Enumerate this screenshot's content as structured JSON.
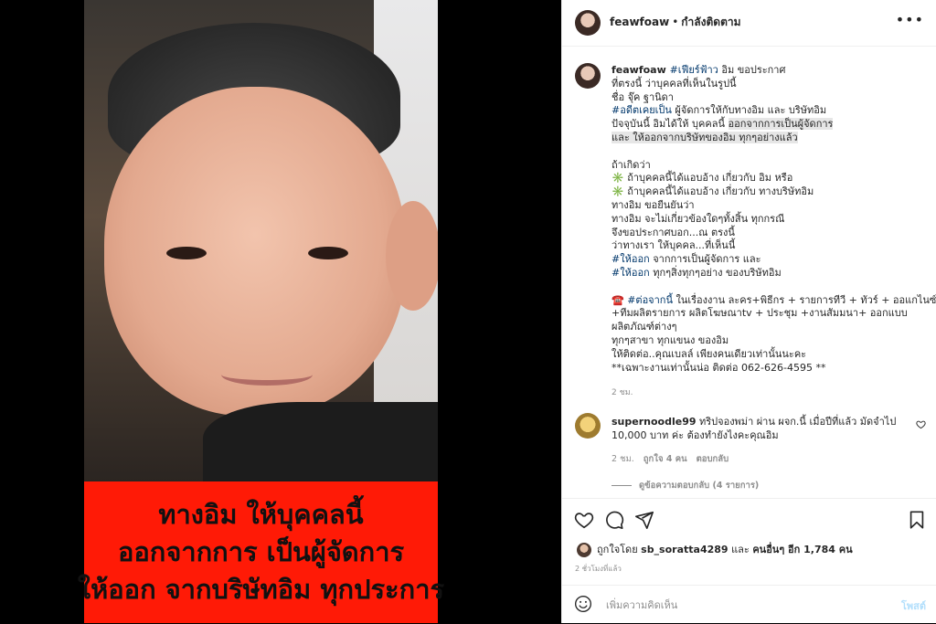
{
  "header": {
    "username": "feawfoaw",
    "separator": "•",
    "follow_status": "กำลังติดตาม",
    "more_icon": "more-horizontal-icon"
  },
  "photo_caption_lines": [
    "ทางอิม ให้บุคคลนี้",
    "ออกจากการ เป็นผู้จัดการ",
    "ให้ออก จากบริษัทอิม ทุกประการ"
  ],
  "caption": {
    "username": "feawfoaw",
    "lines": [
      {
        "parts": [
          {
            "t": "#เฟียร์ฟ้าว",
            "cls": "tag"
          },
          {
            "t": " อิม ขอประกาศ",
            "cls": ""
          }
        ]
      },
      {
        "parts": [
          {
            "t": "ที่ตรงนี้ ว่าบุคคลที่เห็นในรูปนี้",
            "cls": ""
          }
        ]
      },
      {
        "parts": [
          {
            "t": "ชื่อ จุ๊ค ฐานิดา",
            "cls": ""
          }
        ]
      },
      {
        "parts": [
          {
            "t": "#อดีตเคยเป็น",
            "cls": "tag"
          },
          {
            "t": " ผู้จัดการให้กับทางอิม และ บริษัทอิม",
            "cls": ""
          }
        ]
      },
      {
        "parts": [
          {
            "t": "ปัจจุบันนี้ อิมได้ให้ บุคคลนี้ ",
            "cls": ""
          },
          {
            "t": "ออกจากการเป็นผู้จัดการ",
            "cls": "hl"
          }
        ]
      },
      {
        "parts": [
          {
            "t": "และ ให้ออกจากบริษัทของอิม ทุกๆอย่างแล้ว",
            "cls": "hl"
          }
        ]
      },
      {
        "blank": true
      },
      {
        "parts": [
          {
            "t": "ถ้าเกิดว่า",
            "cls": ""
          }
        ]
      },
      {
        "parts": [
          {
            "t": "✳️ ถ้าบุคคลนี้ได้แอบอ้าง เกี่ยวกับ อิม หรือ",
            "cls": ""
          }
        ]
      },
      {
        "parts": [
          {
            "t": "✳️ ถ้าบุคคลนี้ได้แอบอ้าง เกี่ยวกับ ทางบริษัทอิม",
            "cls": ""
          }
        ]
      },
      {
        "parts": [
          {
            "t": "ทางอิม ขอยืนยันว่า",
            "cls": ""
          }
        ]
      },
      {
        "parts": [
          {
            "t": "ทางอิม จะไม่เกี่ยวข้องใดๆทั้งสิ้น ทุกกรณี",
            "cls": ""
          }
        ]
      },
      {
        "parts": [
          {
            "t": "จึงขอประกาศบอก...ณ ตรงนี้",
            "cls": ""
          }
        ]
      },
      {
        "parts": [
          {
            "t": "ว่าทางเรา ให้บุคคล...ที่เห็นนี้",
            "cls": ""
          }
        ]
      },
      {
        "parts": [
          {
            "t": "#ให้ออก",
            "cls": "tag"
          },
          {
            "t": " จากการเป็นผู้จัดการ และ",
            "cls": ""
          }
        ]
      },
      {
        "parts": [
          {
            "t": "#ให้ออก",
            "cls": "tag"
          },
          {
            "t": " ทุกๆสิ่งทุกๆอย่าง ของบริษัทอิม",
            "cls": ""
          }
        ]
      },
      {
        "blank": true
      },
      {
        "parts": [
          {
            "t": "☎️ ",
            "cls": ""
          },
          {
            "t": "#ต่อจากนี้",
            "cls": "tag"
          },
          {
            "t": " ในเรื่องงาน ละคร+พิธีกร + รายการทีวี + ทัวร์ + ออแกไนซ์",
            "cls": ""
          }
        ]
      },
      {
        "parts": [
          {
            "t": "+ทีมผลิตรายการ ผลิตโฆษณาtv + ประชุม +งานสัมมนา+ ออกแบบ",
            "cls": ""
          }
        ]
      },
      {
        "parts": [
          {
            "t": "ผลิตภัณฑ์ต่างๆ",
            "cls": ""
          }
        ]
      },
      {
        "parts": [
          {
            "t": "ทุกๆสาขา ทุกแขนง ของอิม",
            "cls": ""
          }
        ]
      },
      {
        "parts": [
          {
            "t": "ให้ติดต่อ..คุณเบลล์ เพียงคนเดียวเท่านั้นนะคะ",
            "cls": ""
          }
        ]
      },
      {
        "parts": [
          {
            "t": "**เฉพาะงานเท่านั้นน่อ ติดต่อ 062-626-4595 **",
            "cls": ""
          }
        ]
      }
    ],
    "time": "2 ชม."
  },
  "reply": {
    "username": "supernoodle99",
    "text": " ทริปจองพม่า ผ่าน ผจก.นี้ เมื่อปีที่แล้ว มัดจำไป 10,000 บาท ค่ะ ต้องทำยังไงคะคุณอิม",
    "time": "2 ชม.",
    "likes": "ถูกใจ 4 คน",
    "reply_label": "ตอบกลับ",
    "view_replies": "ดูข้อความตอบกลับ (4 รายการ)"
  },
  "actions": {
    "like_icon": "heart-icon",
    "comment_icon": "comment-icon",
    "share_icon": "send-icon",
    "save_icon": "bookmark-icon"
  },
  "likes": {
    "prefix": "ถูกใจโดย ",
    "user": "sb_soratta4289",
    "middle": " และ ",
    "others": "คนอื่นๆ อีก 1,784 คน"
  },
  "posted": "2 ชั่วโมงที่แล้ว",
  "add_comment": {
    "placeholder": "เพิ่มความคิดเห็น",
    "post_label": "โพสต์"
  }
}
